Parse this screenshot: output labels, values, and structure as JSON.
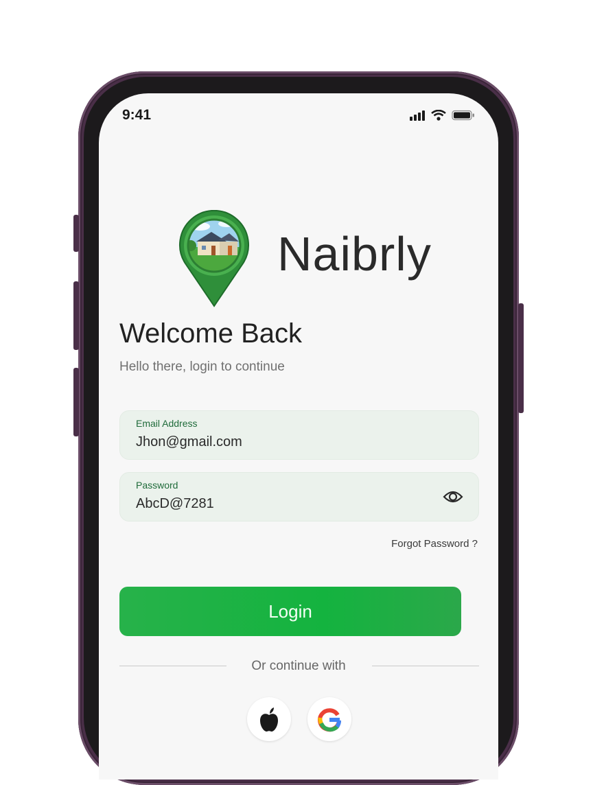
{
  "status_bar": {
    "time": "9:41"
  },
  "brand": {
    "name": "Naibrly"
  },
  "header": {
    "title": "Welcome Back",
    "subtitle": "Hello there, login to continue"
  },
  "form": {
    "email": {
      "label": "Email Address",
      "value": "Jhon@gmail.com"
    },
    "password": {
      "label": "Password",
      "value": "AbcD@7281"
    },
    "forgot_label": "Forgot Password ?",
    "login_label": "Login"
  },
  "social": {
    "divider_text": "Or continue with",
    "providers": [
      "apple-icon",
      "google-icon"
    ]
  },
  "colors": {
    "accent": "#14b33f",
    "field_bg": "#ebf2ec",
    "field_label": "#1f6b3a",
    "phone_frame": "#4a2f48"
  }
}
